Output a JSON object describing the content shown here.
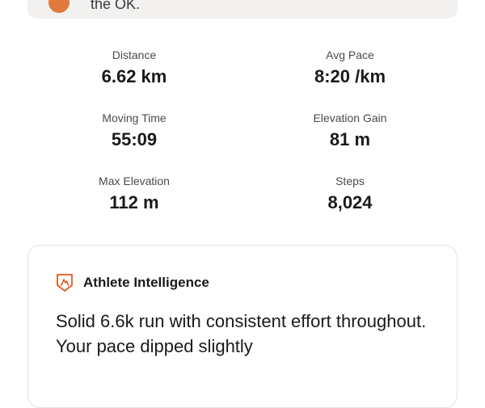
{
  "top_card": {
    "text": "the OK."
  },
  "stats": [
    {
      "label": "Distance",
      "value": "6.62 km"
    },
    {
      "label": "Avg Pace",
      "value": "8:20 /km"
    },
    {
      "label": "Moving Time",
      "value": "55:09"
    },
    {
      "label": "Elevation Gain",
      "value": "81 m"
    },
    {
      "label": "Max Elevation",
      "value": "112 m"
    },
    {
      "label": "Steps",
      "value": "8,024"
    }
  ],
  "ai_card": {
    "title": "Athlete Intelligence",
    "icon": "athlete-intelligence-badge-icon",
    "accent": "#e05a1f",
    "body": "Solid 6.6k run with consistent effort throughout. Your pace dipped slightly"
  }
}
